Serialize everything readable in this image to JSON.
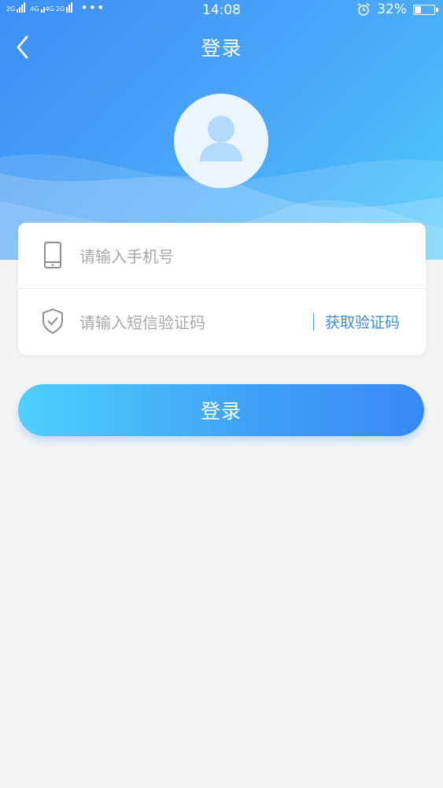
{
  "status_bar": {
    "signal_labels": [
      "2G",
      "4G",
      "4G",
      "2G"
    ],
    "time": "14:08",
    "battery_text": "32%",
    "battery_level": 0.32
  },
  "nav": {
    "title": "登录",
    "back_icon": "chevron-left-icon"
  },
  "avatar": {
    "icon": "user-icon"
  },
  "form": {
    "phone_placeholder": "请输入手机号",
    "phone_icon": "mobile-phone-icon",
    "code_placeholder": "请输入短信验证码",
    "code_icon": "shield-check-icon",
    "get_code_label": "获取验证码"
  },
  "login_button_label": "登录",
  "colors": {
    "primary": "#3d8ef5",
    "accent_light": "#4ccafd",
    "link": "#3b8fe0",
    "background": "#f4f4f5"
  }
}
